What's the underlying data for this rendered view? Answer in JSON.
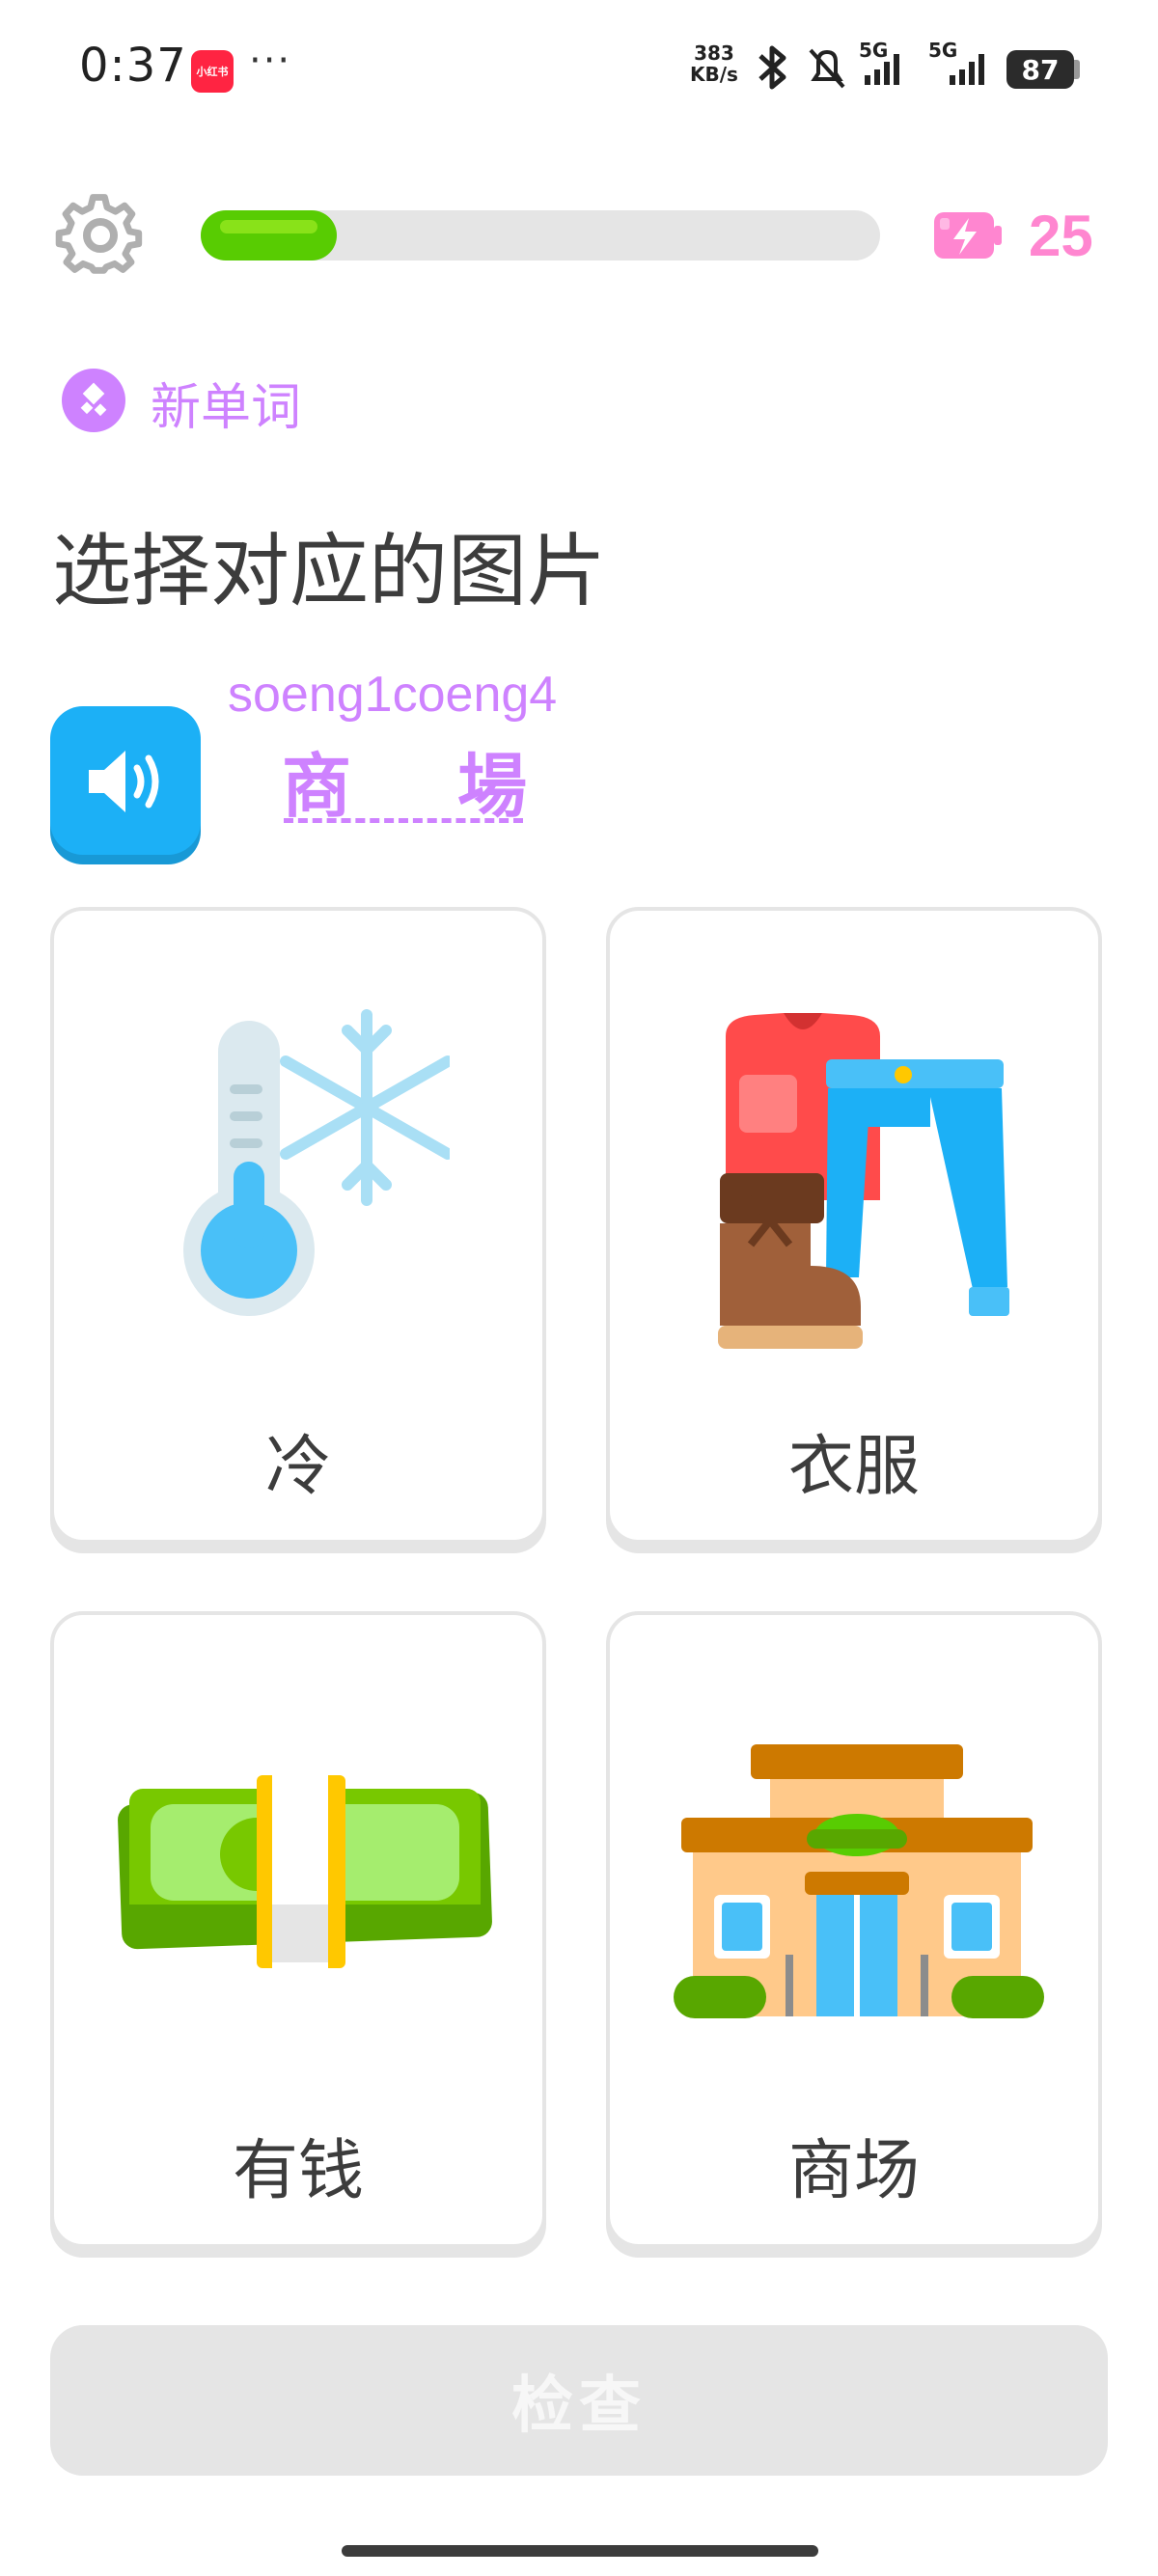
{
  "status_bar": {
    "time": "0:37",
    "app_badge": "小红书",
    "dots": "···",
    "net_speed_value": "383",
    "net_speed_unit": "KB/s",
    "sig1": "5G",
    "sig2": "5G",
    "battery": "87"
  },
  "header": {
    "energy": "25",
    "progress_fraction": 0.2,
    "icons": [
      "gear-icon",
      "energy-battery-icon"
    ]
  },
  "lesson": {
    "tag": "新单词",
    "prompt": "选择对应的图片",
    "romanization": "soeng1coeng4",
    "word_char1": "商",
    "word_char2": "場"
  },
  "choices": [
    {
      "label": "冷",
      "icon": "thermometer-snowflake-icon"
    },
    {
      "label": "衣服",
      "icon": "clothes-icon"
    },
    {
      "label": "有钱",
      "icon": "money-icon"
    },
    {
      "label": "商场",
      "icon": "mall-building-icon"
    }
  ],
  "footer": {
    "check_label": "检查"
  },
  "colors": {
    "accent_purple": "#ce82ff",
    "progress_green": "#58cc02",
    "speaker_blue": "#1cb0f6",
    "energy_pink": "#ff86d0"
  }
}
